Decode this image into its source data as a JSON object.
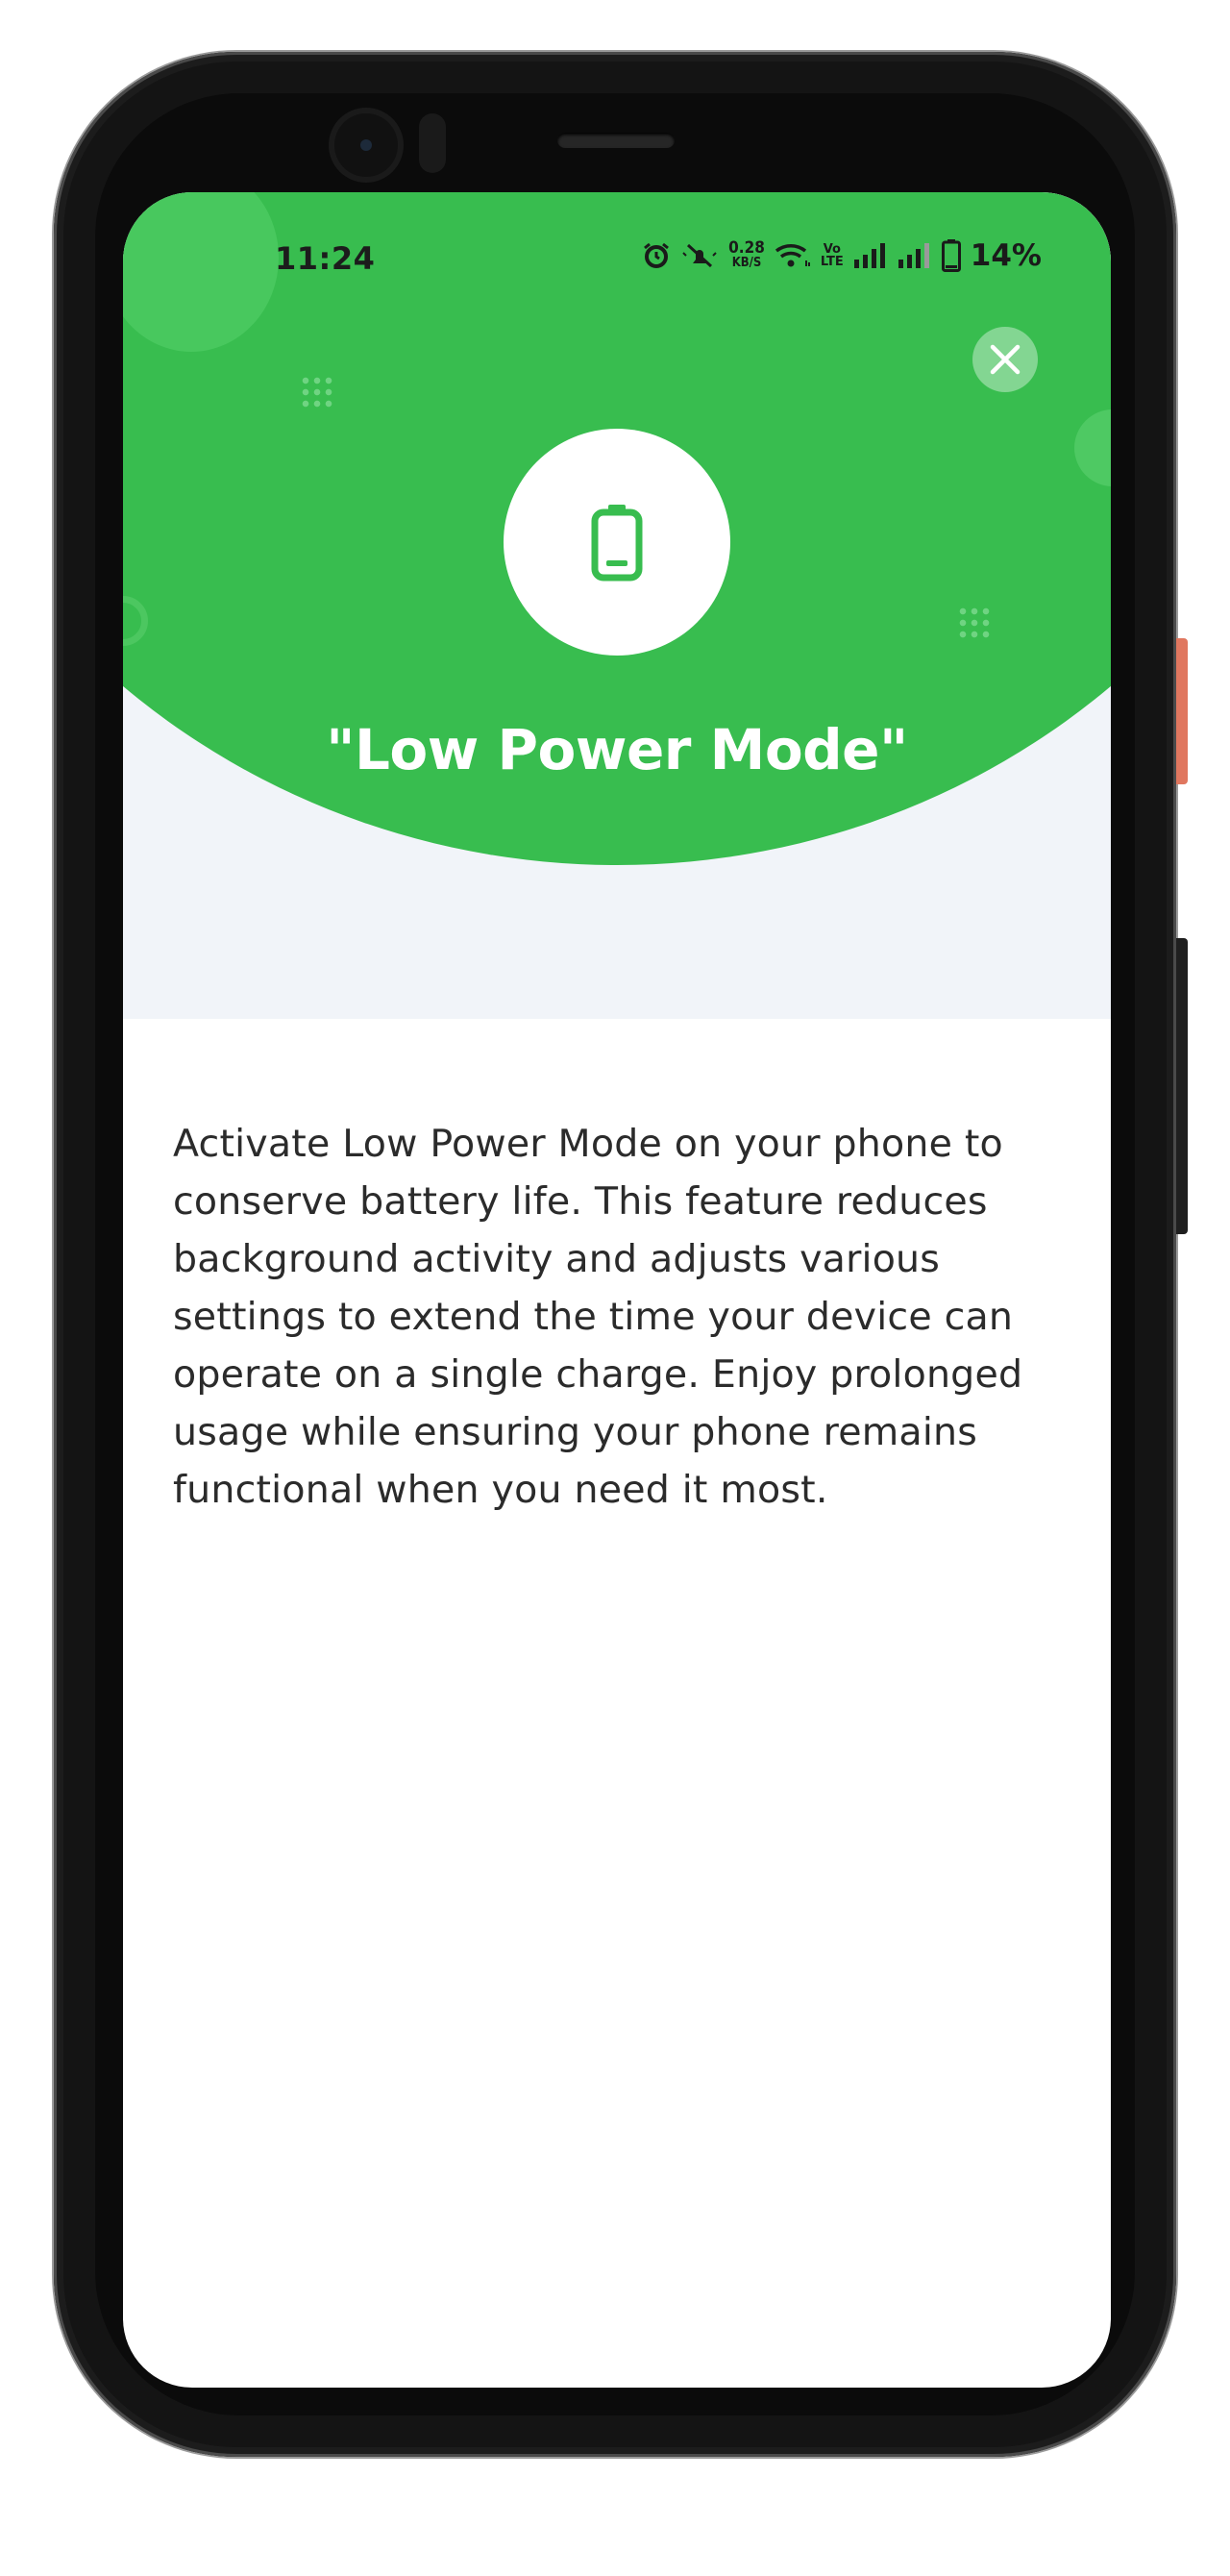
{
  "status_bar": {
    "time": "11:24",
    "net_speed_value": "0.28",
    "net_speed_unit": "KB/S",
    "volte_line1": "Vo",
    "volte_line2": "LTE",
    "battery_percent": "14%",
    "icons": [
      "alarm-icon",
      "mute-icon",
      "wifi-icon",
      "volte-icon",
      "signal-icon",
      "signal-icon",
      "battery-icon"
    ]
  },
  "hero": {
    "icon": "battery-low-icon",
    "title": "\"Low Power Mode\"",
    "close_icon": "close-icon"
  },
  "body": {
    "description": "Activate Low Power Mode on your phone to conserve battery life. This feature reduces background activity and adjusts various settings to extend the time your device can operate on a single charge. Enjoy prolonged usage while ensuring your phone remains functional when you need it most."
  },
  "colors": {
    "accent_green": "#38bd4f",
    "hero_background": "#f1f4f9",
    "text": "#2b2b2b"
  }
}
